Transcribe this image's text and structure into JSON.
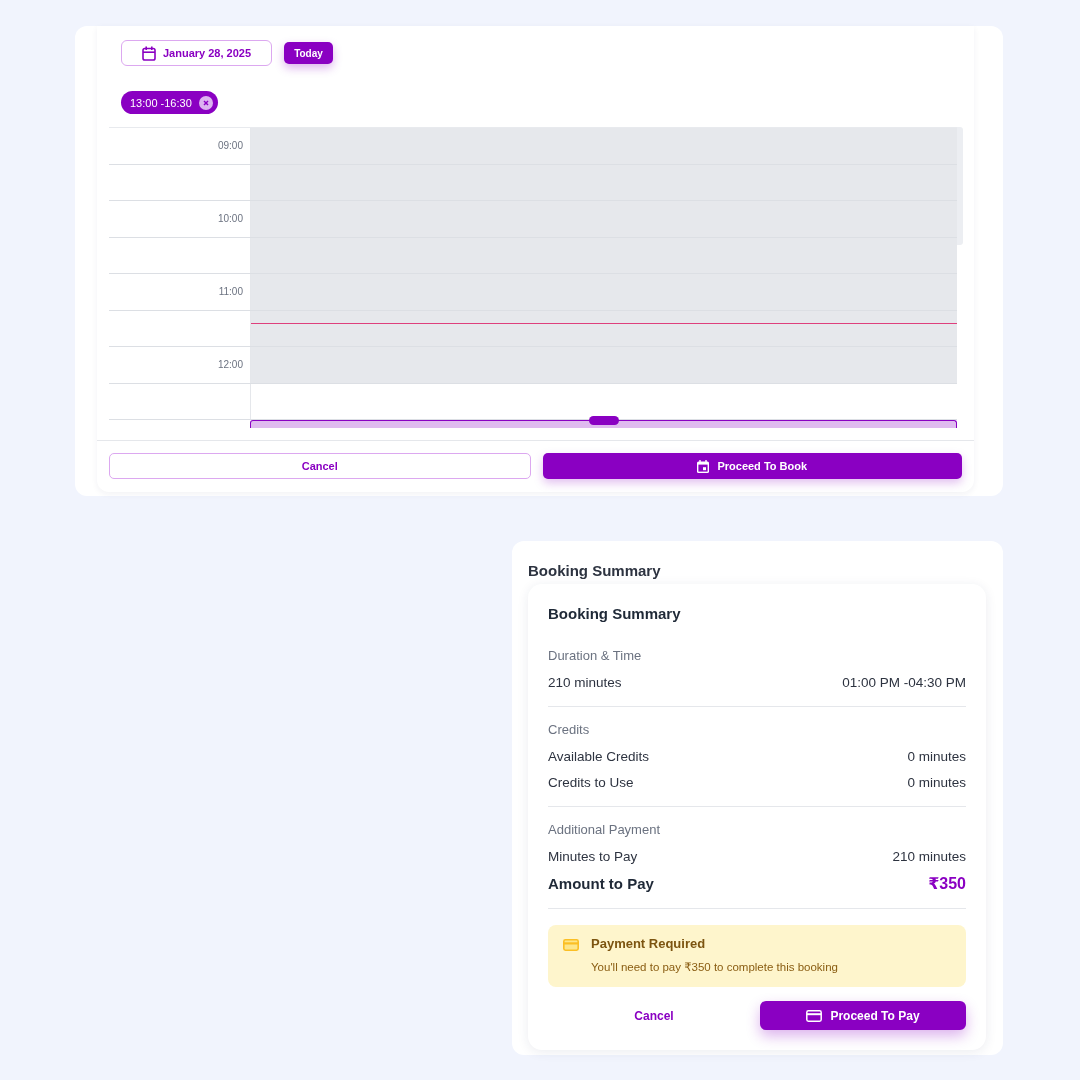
{
  "date_picker": {
    "date": "January 28, 2025",
    "today_label": "Today"
  },
  "selected_ranges": [
    {
      "label": "13:00 -16:30"
    }
  ],
  "calendar": {
    "slots": [
      {
        "label": "09:00",
        "disabled": true,
        "selected": false,
        "now": false
      },
      {
        "disabled": true,
        "selected": false,
        "now": false
      },
      {
        "label": "10:00",
        "disabled": true,
        "selected": false,
        "now": false
      },
      {
        "disabled": true,
        "selected": false,
        "now": false
      },
      {
        "label": "11:00",
        "disabled": true,
        "selected": false,
        "now": false
      },
      {
        "disabled": true,
        "selected": false,
        "now": true
      },
      {
        "label": "12:00",
        "disabled": true,
        "selected": false,
        "now": false
      },
      {
        "disabled": false,
        "selected": false,
        "now": false
      },
      {
        "disabled": false,
        "selected": true,
        "now": false
      }
    ]
  },
  "actions": [
    {
      "label": "Cancel",
      "kind": "secondary"
    },
    {
      "label": "Proceed To Book",
      "kind": "primary"
    }
  ],
  "summary": {
    "heading": "Booking Summary",
    "card": {
      "title": "Booking Summary",
      "sections": [
        {
          "title": "Duration & Time",
          "rows": [
            {
              "label": "210 minutes",
              "value": "01:00 PM -04:30 PM",
              "kind": "line"
            }
          ]
        },
        {
          "title": "Credits",
          "rows": [
            {
              "label": "Available Credits",
              "value": "0 minutes",
              "kind": "line"
            },
            {
              "label": "Credits to Use",
              "value": "0 minutes",
              "kind": "line"
            }
          ]
        },
        {
          "title": "Additional Payment",
          "rows": [
            {
              "label": "Minutes to Pay",
              "value": "210 minutes",
              "kind": "line"
            },
            {
              "label": "Amount to Pay",
              "value": "₹350",
              "kind": "total"
            }
          ]
        }
      ],
      "alert": {
        "title": "Payment Required",
        "message": "You'll need to pay ₹350 to complete this booking"
      },
      "actions": [
        {
          "label": "Cancel",
          "kind": "text"
        },
        {
          "label": "Proceed To Pay",
          "kind": "primary"
        }
      ]
    }
  }
}
